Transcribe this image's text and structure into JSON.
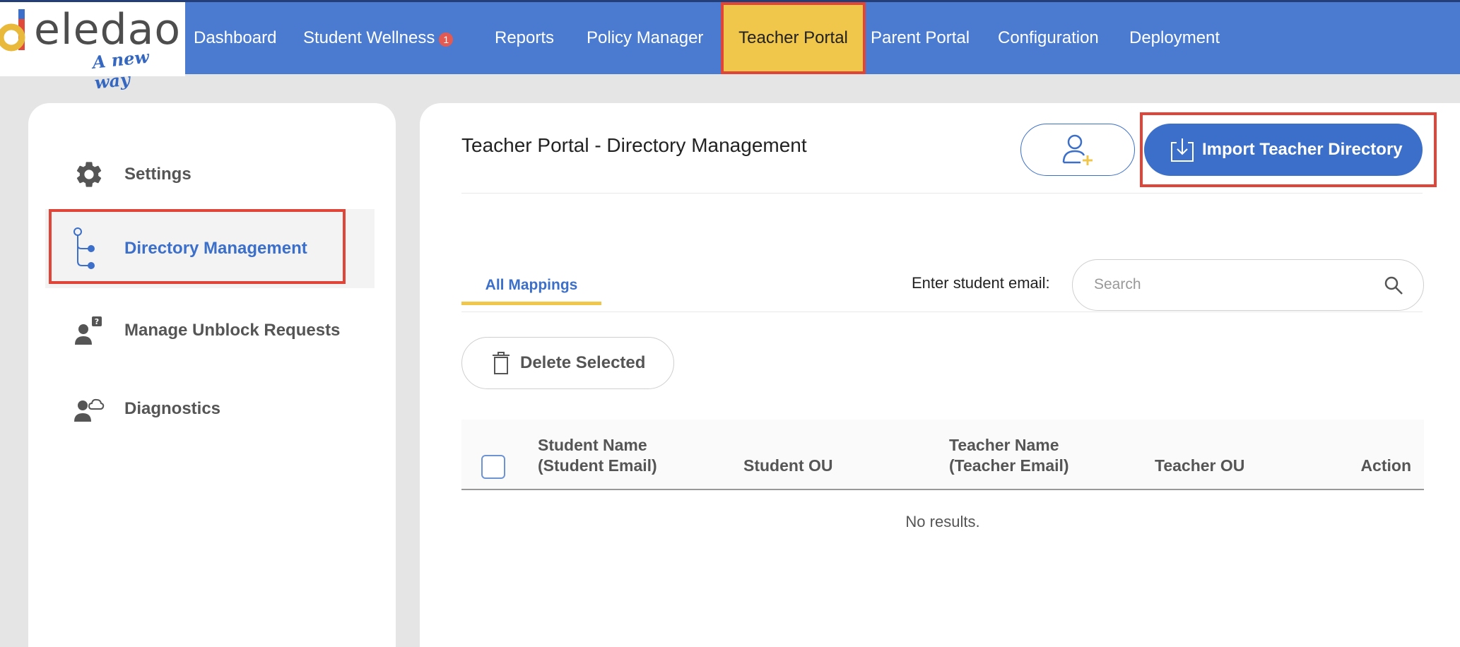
{
  "brand": {
    "name": "eledao",
    "tagline": "A new way"
  },
  "nav": {
    "items": [
      {
        "label": "Dashboard"
      },
      {
        "label": "Student Wellness",
        "badge": "1"
      },
      {
        "label": "Reports"
      },
      {
        "label": "Policy Manager"
      },
      {
        "label": "Teacher Portal"
      },
      {
        "label": "Parent Portal"
      },
      {
        "label": "Configuration"
      },
      {
        "label": "Deployment"
      }
    ],
    "active": "Teacher Portal"
  },
  "sidebar": {
    "items": [
      {
        "label": "Settings",
        "icon": "gear-icon"
      },
      {
        "label": "Directory Management",
        "icon": "tree-icon"
      },
      {
        "label": "Manage Unblock Requests",
        "icon": "user-question-icon"
      },
      {
        "label": "Diagnostics",
        "icon": "user-cloud-icon"
      }
    ],
    "active": "Directory Management"
  },
  "main": {
    "title": "Teacher Portal - Directory Management",
    "import_label": "Import Teacher Directory",
    "tabs": [
      {
        "label": "All Mappings"
      }
    ],
    "search": {
      "label": "Enter student email:",
      "placeholder": "Search"
    },
    "delete_label": "Delete Selected",
    "table": {
      "columns": [
        {
          "line1": "Student Name",
          "line2": "(Student Email)"
        },
        {
          "line1": "Student OU",
          "line2": ""
        },
        {
          "line1": "Teacher Name",
          "line2": "(Teacher Email)"
        },
        {
          "line1": "Teacher OU",
          "line2": ""
        },
        {
          "line1": "Action",
          "line2": ""
        }
      ],
      "empty_message": "No results."
    }
  },
  "colors": {
    "nav_bg": "#4a7bd0",
    "accent_blue": "#3b6fc9",
    "active_tab_yellow": "#f0c64b",
    "highlight_red": "#e0453a",
    "logo_yellow": "#e8b93a"
  }
}
